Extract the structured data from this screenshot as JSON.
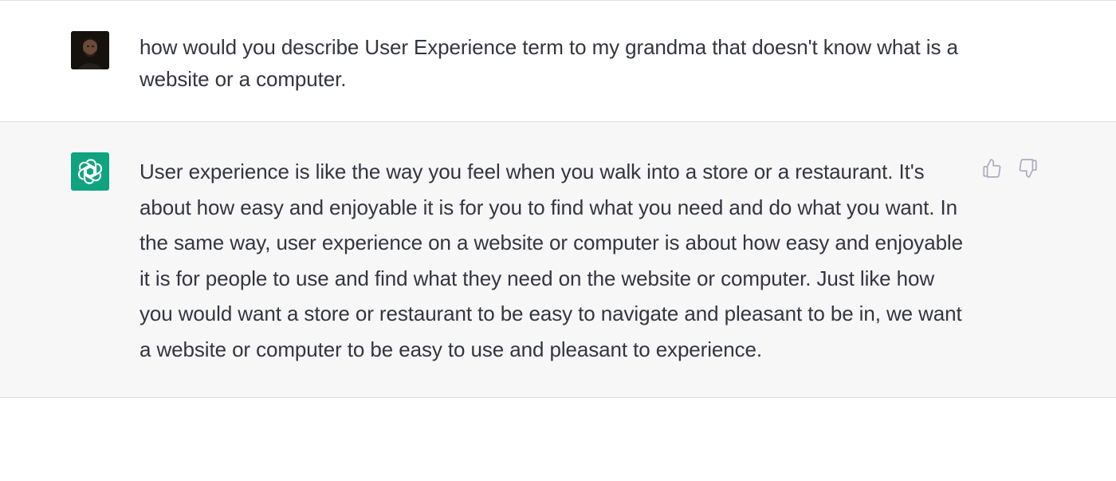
{
  "conversation": {
    "user_message": {
      "avatar_icon": "user-photo-avatar",
      "text": "how would you describe User Experience term to my grandma that doesn't know what is a website or a computer."
    },
    "assistant_message": {
      "avatar_icon": "openai-logo-icon",
      "avatar_color": "#10a37f",
      "text": "User experience is like the way you feel when you walk into a store or a restaurant. It's about how easy and enjoyable it is for you to find what you need and do what you want. In the same way, user experience on a website or computer is about how easy and enjoyable it is for people to use and find what they need on the website or computer. Just like how you would want a store or restaurant to be easy to navigate and pleasant to be in, we want a website or computer to be easy to use and pleasant to experience.",
      "feedback": {
        "thumbs_up_icon": "thumbs-up-icon",
        "thumbs_down_icon": "thumbs-down-icon"
      }
    }
  },
  "colors": {
    "text": "#343541",
    "assistant_bg": "#f7f7f8",
    "border": "#d9d9e3",
    "icon_gray": "#acacbe"
  }
}
